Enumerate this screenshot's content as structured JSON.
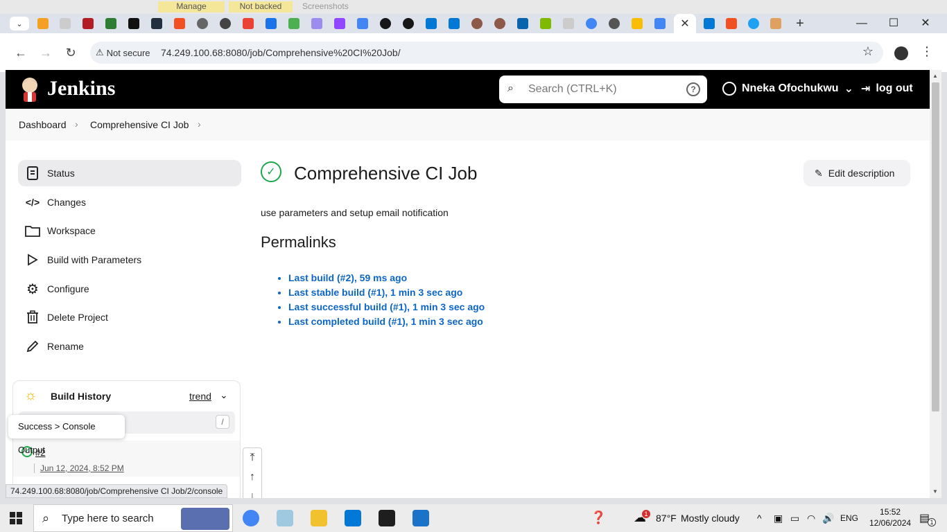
{
  "top_strip": {
    "chip_manage": "Manage",
    "chip_not_backed_up": "Not backed up",
    "chip_screenshots": "Screenshots"
  },
  "browser": {
    "security_label": "Not secure",
    "url": "74.249.100.68:8080/job/Comprehensive%20CI%20Job/"
  },
  "jenkins": {
    "brand": "Jenkins",
    "search_placeholder": "Search (CTRL+K)",
    "help_label": "?",
    "user_name": "Nneka Ofochukwu",
    "logout_label": "log out"
  },
  "breadcrumb": [
    "Dashboard",
    "Comprehensive CI Job"
  ],
  "sidebar": {
    "items": [
      {
        "label": "Status",
        "icon": "document-icon"
      },
      {
        "label": "Changes",
        "icon": "code-icon"
      },
      {
        "label": "Workspace",
        "icon": "folder-icon"
      },
      {
        "label": "Build with Parameters",
        "icon": "play-icon"
      },
      {
        "label": "Configure",
        "icon": "gear-icon"
      },
      {
        "label": "Delete Project",
        "icon": "trash-icon"
      },
      {
        "label": "Rename",
        "icon": "pencil-icon"
      }
    ]
  },
  "build_history": {
    "title": "Build History",
    "trend_label": "trend",
    "filter_shortcut": "/",
    "builds": [
      {
        "number": "#2",
        "date": "Jun 12, 2024, 8:52 PM",
        "status": "success"
      }
    ],
    "tooltip": "Success > Console Output"
  },
  "main": {
    "job_title": "Comprehensive CI Job",
    "edit_description_label": "Edit description",
    "description": "use parameters and setup email notification",
    "permalinks_heading": "Permalinks",
    "permalinks": [
      "Last build (#2), 59 ms ago",
      "Last stable build (#1), 1 min 3 sec ago",
      "Last successful build (#1), 1 min 3 sec ago",
      "Last completed build (#1), 1 min 3 sec ago"
    ]
  },
  "status_url": "74.249.100.68:8080/job/Comprehensive CI Job/2/console",
  "taskbar": {
    "search_placeholder": "Type here to search",
    "weather_temp": "87°F",
    "weather_desc": "Mostly cloudy",
    "weather_badge": "1",
    "language": "ENG",
    "time": "15:52",
    "date": "12/06/2024",
    "notification_count": "1"
  },
  "colors": {
    "jenkins_header": "#000000",
    "link_blue": "#0c66c6",
    "success_green": "#1ea64b"
  }
}
